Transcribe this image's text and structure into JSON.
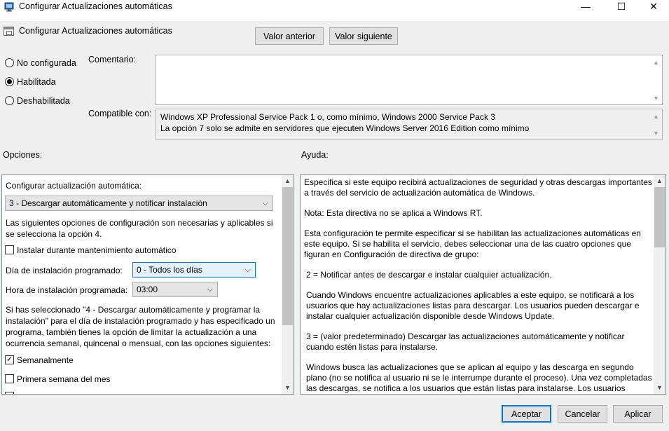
{
  "window": {
    "title": "Configurar Actualizaciones automáticas",
    "minimize_glyph": "—",
    "maximize_glyph": "☐",
    "close_glyph": "✕"
  },
  "header": {
    "policy_name": "Configurar Actualizaciones automáticas",
    "prev_label": "Valor anterior",
    "next_label": "Valor siguiente"
  },
  "state": {
    "not_configured": "No configurada",
    "enabled": "Habilitada",
    "disabled": "Deshabilitada",
    "selected": "enabled"
  },
  "comment": {
    "label": "Comentario:",
    "value": ""
  },
  "compat": {
    "label": "Compatible con:",
    "line1": "Windows XP Professional Service Pack 1 o, como mínimo, Windows 2000 Service Pack 3",
    "line2": "La opción 7 solo se admite en servidores que ejecuten Windows Server 2016 Edition como mínimo"
  },
  "sections": {
    "options_label": "Opciones:",
    "help_label": "Ayuda:"
  },
  "options": {
    "auto_update_label": "Configurar actualización automática:",
    "auto_update_value": "3 - Descargar automáticamente y notificar instalación",
    "note": "Las siguientes opciones de configuración son necesarias y aplicables si se selecciona la opción 4.",
    "maintenance_label": "Instalar durante mantenimiento automático",
    "maintenance_checked": false,
    "day_label": "Día de instalación programado:",
    "day_value": "0 - Todos los días",
    "hour_label": "Hora de instalación programada:",
    "hour_value": "03:00",
    "weekly_note": "Si has seleccionado \"4 - Descargar automáticamente y programar la instalación\" para el día de instalación programado y has especificado un programa, también tienes la opción de limitar la actualización a una ocurrencia semanal, quincenal o mensual, con las opciones siguientes:",
    "weekly_label": "Semanalmente",
    "weekly_checked": true,
    "first_week_label": "Primera semana del mes",
    "first_week_checked": false,
    "check_mark": "✓"
  },
  "help": {
    "p1": "Especifica si este equipo recibirá actualizaciones de seguridad y otras descargas importantes a través del servicio de actualización automática de Windows.",
    "p2": "Nota: Esta directiva no se aplica a Windows RT.",
    "p3": "Esta configuración te permite especificar si se habilitan las actualizaciones automáticas en este equipo. Si se habilita el servicio, debes seleccionar una de las cuatro opciones que figuran en Configuración de directiva de grupo:",
    "p4": "2 = Notificar antes de descargar e instalar cualquier actualización.",
    "p5": "Cuando Windows encuentre actualizaciones aplicables a este equipo, se notificará a los usuarios que hay actualizaciones listas para descargar. Los usuarios pueden descargar e instalar cualquier actualización disponible desde Windows Update.",
    "p6": "3 = (valor predeterminado) Descargar las actualizaciones automáticamente y notificar cuando estén listas para instalarse.",
    "p7": "Windows busca las actualizaciones que se aplican al equipo y las descarga en segundo plano (no se notifica al usuario ni se le interrumpe durante el proceso). Una vez completadas las descargas, se notifica a los usuarios que están listas para instalarse. Los usuarios pueden"
  },
  "footer": {
    "ok_label": "Aceptar",
    "cancel_label": "Cancelar",
    "apply_label": "Aplicar"
  },
  "icons": {
    "chevron_down": "⌵",
    "arrow_up": "▲",
    "arrow_down": "▼"
  }
}
